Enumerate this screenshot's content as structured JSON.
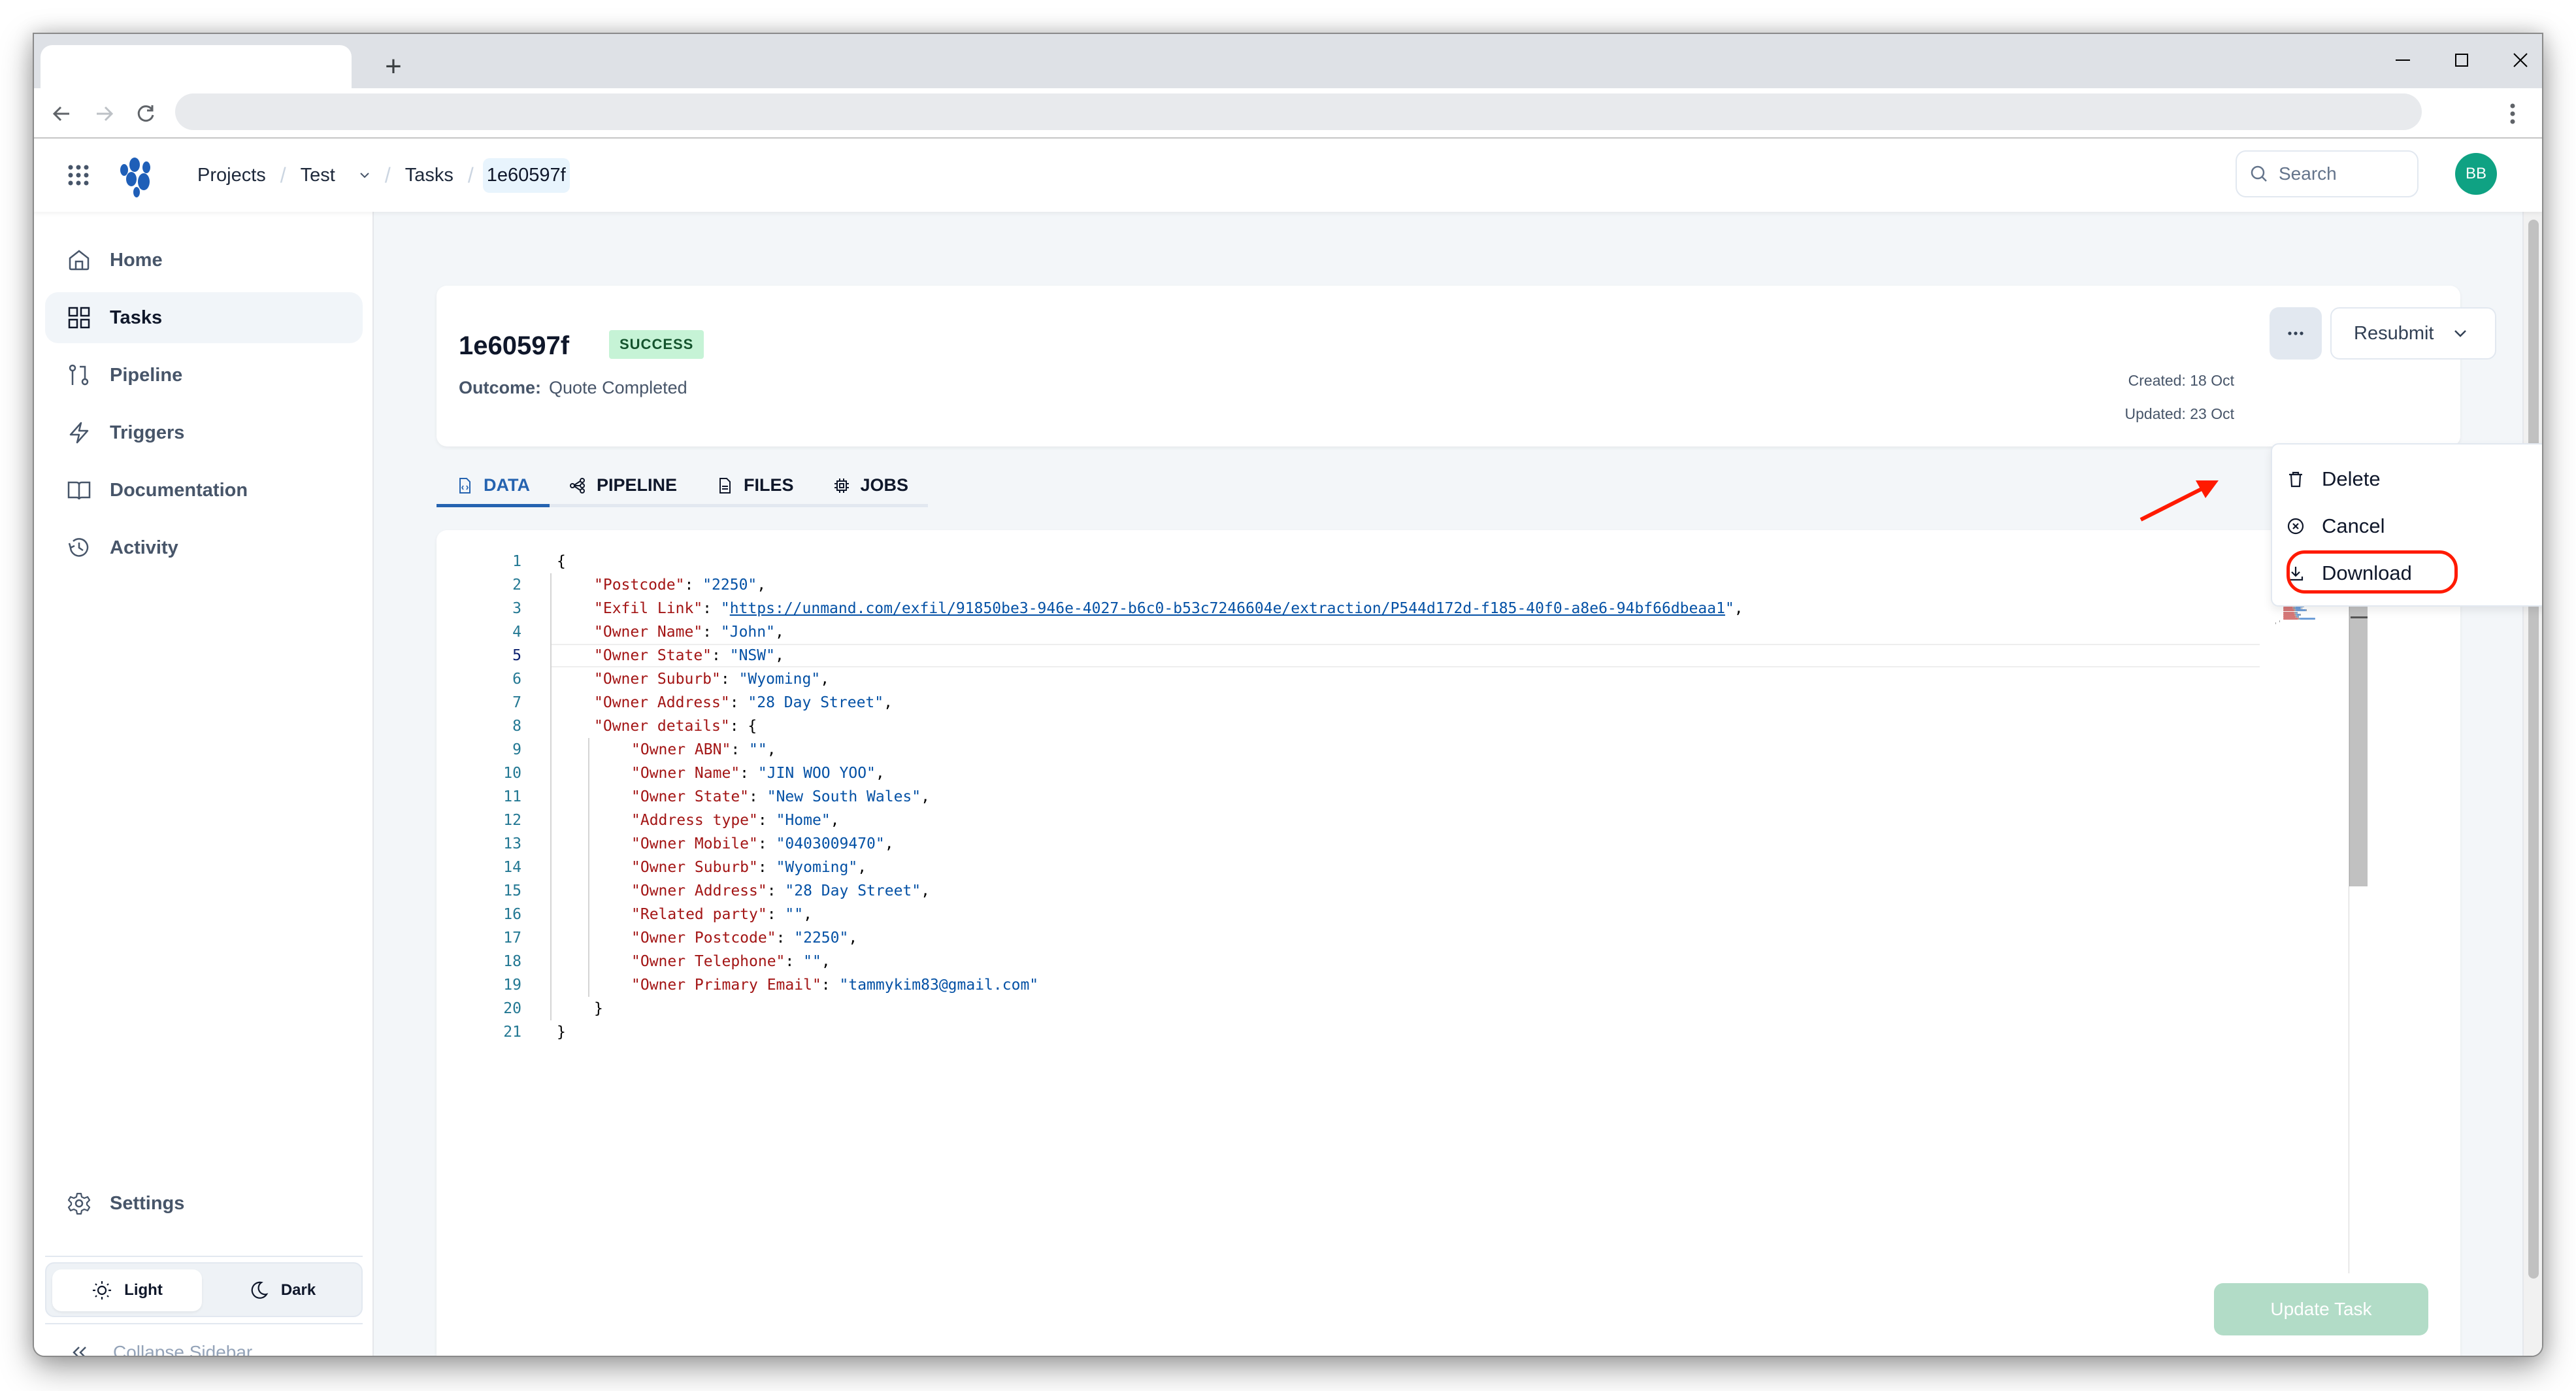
{
  "browser": {
    "new_tab_label": "+",
    "window_controls": [
      "minimize",
      "maximize",
      "close"
    ]
  },
  "header": {
    "breadcrumbs": [
      {
        "label": "Projects"
      },
      {
        "label": "Test",
        "has_dropdown": true
      },
      {
        "label": "Tasks"
      },
      {
        "label": "1e60597f",
        "current": true
      }
    ],
    "search_placeholder": "Search",
    "avatar_initials": "BB",
    "avatar_color": "#0fa283",
    "brand_color": "#1f5fb8"
  },
  "sidebar": {
    "items": [
      {
        "label": "Home",
        "icon": "home-icon"
      },
      {
        "label": "Tasks",
        "icon": "grid-icon",
        "active": true
      },
      {
        "label": "Pipeline",
        "icon": "git-pull-request-icon"
      },
      {
        "label": "Triggers",
        "icon": "zap-icon"
      },
      {
        "label": "Documentation",
        "icon": "book-icon"
      },
      {
        "label": "Activity",
        "icon": "history-icon"
      }
    ],
    "settings_label": "Settings",
    "theme": {
      "light_label": "Light",
      "dark_label": "Dark",
      "selected": "Light"
    },
    "collapse_label": "Collapse Sidebar"
  },
  "task": {
    "id": "1e60597f",
    "status": "SUCCESS",
    "status_color": "#c6f3d6",
    "outcome_label": "Outcome:",
    "outcome_value": "Quote Completed",
    "created": "Created: 18 Oct",
    "updated": "Updated: 23 Oct",
    "more_label": "...",
    "resubmit_label": "Resubmit"
  },
  "actions_menu": {
    "items": [
      {
        "label": "Delete",
        "icon": "trash-icon"
      },
      {
        "label": "Cancel",
        "icon": "x-circle-icon"
      },
      {
        "label": "Download",
        "icon": "download-icon",
        "highlighted": true
      }
    ],
    "annotation_color": "#ff1a00"
  },
  "tabs": [
    {
      "label": "DATA",
      "icon": "file-code-icon",
      "active": true
    },
    {
      "label": "PIPELINE",
      "icon": "share-nodes-icon"
    },
    {
      "label": "FILES",
      "icon": "file-text-icon"
    },
    {
      "label": "JOBS",
      "icon": "cpu-icon"
    }
  ],
  "editor": {
    "current_line": 5,
    "lines": [
      {
        "n": "1",
        "indent": 0,
        "parts": [
          [
            "p",
            "{"
          ]
        ]
      },
      {
        "n": "2",
        "indent": 1,
        "parts": [
          [
            "k",
            "\"Postcode\""
          ],
          [
            "p",
            ": "
          ],
          [
            "s",
            "\"2250\""
          ],
          [
            "p",
            ","
          ]
        ]
      },
      {
        "n": "3",
        "indent": 1,
        "parts": [
          [
            "k",
            "\"Exfil Link\""
          ],
          [
            "p",
            ": "
          ],
          [
            "s",
            "\""
          ],
          [
            "u",
            "https://unmand.com/exfil/91850be3-946e-4027-b6c0-b53c7246604e/extraction/P544d172d-f185-40f0-a8e6-94bf66dbeaa1"
          ],
          [
            "s",
            "\""
          ],
          [
            "p",
            ","
          ]
        ]
      },
      {
        "n": "4",
        "indent": 1,
        "parts": [
          [
            "k",
            "\"Owner Name\""
          ],
          [
            "p",
            ": "
          ],
          [
            "s",
            "\"John\""
          ],
          [
            "p",
            ","
          ]
        ]
      },
      {
        "n": "5",
        "indent": 1,
        "parts": [
          [
            "k",
            "\"Owner State\""
          ],
          [
            "p",
            ": "
          ],
          [
            "s",
            "\"NSW\""
          ],
          [
            "p",
            ","
          ]
        ]
      },
      {
        "n": "6",
        "indent": 1,
        "parts": [
          [
            "k",
            "\"Owner Suburb\""
          ],
          [
            "p",
            ": "
          ],
          [
            "s",
            "\"Wyoming\""
          ],
          [
            "p",
            ","
          ]
        ]
      },
      {
        "n": "7",
        "indent": 1,
        "parts": [
          [
            "k",
            "\"Owner Address\""
          ],
          [
            "p",
            ": "
          ],
          [
            "s",
            "\"28 Day Street\""
          ],
          [
            "p",
            ","
          ]
        ]
      },
      {
        "n": "8",
        "indent": 1,
        "parts": [
          [
            "k",
            "\"Owner details\""
          ],
          [
            "p",
            ": {"
          ]
        ]
      },
      {
        "n": "9",
        "indent": 2,
        "parts": [
          [
            "k",
            "\"Owner ABN\""
          ],
          [
            "p",
            ": "
          ],
          [
            "s",
            "\"\""
          ],
          [
            "p",
            ","
          ]
        ]
      },
      {
        "n": "10",
        "indent": 2,
        "parts": [
          [
            "k",
            "\"Owner Name\""
          ],
          [
            "p",
            ": "
          ],
          [
            "s",
            "\"JIN WOO YOO\""
          ],
          [
            "p",
            ","
          ]
        ]
      },
      {
        "n": "11",
        "indent": 2,
        "parts": [
          [
            "k",
            "\"Owner State\""
          ],
          [
            "p",
            ": "
          ],
          [
            "s",
            "\"New South Wales\""
          ],
          [
            "p",
            ","
          ]
        ]
      },
      {
        "n": "12",
        "indent": 2,
        "parts": [
          [
            "k",
            "\"Address type\""
          ],
          [
            "p",
            ": "
          ],
          [
            "s",
            "\"Home\""
          ],
          [
            "p",
            ","
          ]
        ]
      },
      {
        "n": "13",
        "indent": 2,
        "parts": [
          [
            "k",
            "\"Owner Mobile\""
          ],
          [
            "p",
            ": "
          ],
          [
            "s",
            "\"0403009470\""
          ],
          [
            "p",
            ","
          ]
        ]
      },
      {
        "n": "14",
        "indent": 2,
        "parts": [
          [
            "k",
            "\"Owner Suburb\""
          ],
          [
            "p",
            ": "
          ],
          [
            "s",
            "\"Wyoming\""
          ],
          [
            "p",
            ","
          ]
        ]
      },
      {
        "n": "15",
        "indent": 2,
        "parts": [
          [
            "k",
            "\"Owner Address\""
          ],
          [
            "p",
            ": "
          ],
          [
            "s",
            "\"28 Day Street\""
          ],
          [
            "p",
            ","
          ]
        ]
      },
      {
        "n": "16",
        "indent": 2,
        "parts": [
          [
            "k",
            "\"Related party\""
          ],
          [
            "p",
            ": "
          ],
          [
            "s",
            "\"\""
          ],
          [
            "p",
            ","
          ]
        ]
      },
      {
        "n": "17",
        "indent": 2,
        "parts": [
          [
            "k",
            "\"Owner Postcode\""
          ],
          [
            "p",
            ": "
          ],
          [
            "s",
            "\"2250\""
          ],
          [
            "p",
            ","
          ]
        ]
      },
      {
        "n": "18",
        "indent": 2,
        "parts": [
          [
            "k",
            "\"Owner Telephone\""
          ],
          [
            "p",
            ": "
          ],
          [
            "s",
            "\"\""
          ],
          [
            "p",
            ","
          ]
        ]
      },
      {
        "n": "19",
        "indent": 2,
        "parts": [
          [
            "k",
            "\"Owner Primary Email\""
          ],
          [
            "p",
            ": "
          ],
          [
            "s",
            "\"tammykim83@gmail.com\""
          ]
        ]
      },
      {
        "n": "20",
        "indent": 1,
        "parts": [
          [
            "p",
            "}"
          ]
        ]
      },
      {
        "n": "21",
        "indent": 0,
        "parts": [
          [
            "p",
            "}"
          ]
        ]
      }
    ]
  },
  "update_button_label": "Update Task",
  "update_button_color": "#b2dcc7"
}
